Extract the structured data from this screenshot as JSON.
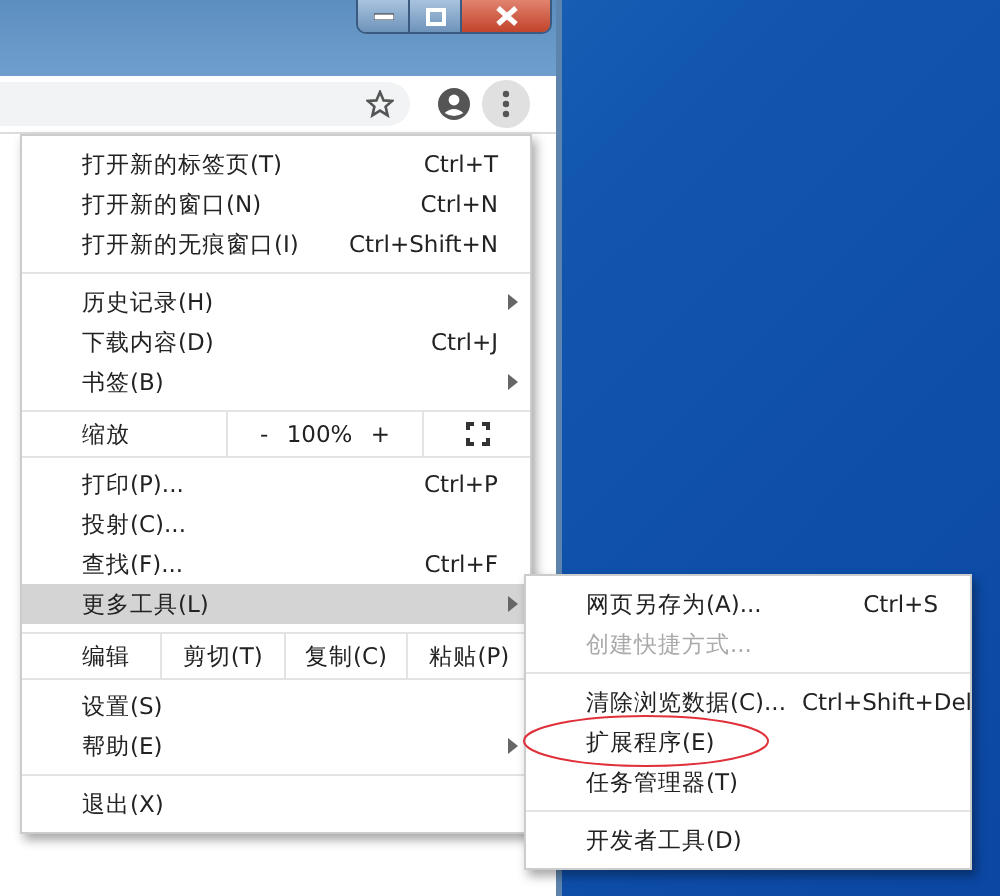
{
  "menu": {
    "items": [
      {
        "kind": "item",
        "label": "打开新的标签页(T)",
        "shortcut": "Ctrl+T",
        "has_submenu": false,
        "selected": false
      },
      {
        "kind": "item",
        "label": "打开新的窗口(N)",
        "shortcut": "Ctrl+N",
        "has_submenu": false,
        "selected": false
      },
      {
        "kind": "item",
        "label": "打开新的无痕窗口(I)",
        "shortcut": "Ctrl+Shift+N",
        "has_submenu": false,
        "selected": false
      },
      {
        "kind": "divider"
      },
      {
        "kind": "item",
        "label": "历史记录(H)",
        "has_submenu": true,
        "selected": false
      },
      {
        "kind": "item",
        "label": "下载内容(D)",
        "shortcut": "Ctrl+J",
        "has_submenu": false,
        "selected": false
      },
      {
        "kind": "item",
        "label": "书签(B)",
        "has_submenu": true,
        "selected": false
      },
      {
        "kind": "zoom",
        "label": "缩放",
        "minus": "-",
        "value": "100%",
        "plus": "+"
      },
      {
        "kind": "item",
        "label": "打印(P)...",
        "shortcut": "Ctrl+P",
        "has_submenu": false,
        "selected": false
      },
      {
        "kind": "item",
        "label": "投射(C)...",
        "has_submenu": false,
        "selected": false
      },
      {
        "kind": "item",
        "label": "查找(F)...",
        "shortcut": "Ctrl+F",
        "has_submenu": false,
        "selected": false
      },
      {
        "kind": "item",
        "label": "更多工具(L)",
        "has_submenu": true,
        "selected": true
      },
      {
        "kind": "edit",
        "label": "编辑",
        "buttons": [
          "剪切(T)",
          "复制(C)",
          "粘贴(P)"
        ]
      },
      {
        "kind": "item",
        "label": "设置(S)",
        "has_submenu": false,
        "selected": false
      },
      {
        "kind": "item",
        "label": "帮助(E)",
        "has_submenu": true,
        "selected": false
      },
      {
        "kind": "divider"
      },
      {
        "kind": "item",
        "label": "退出(X)",
        "has_submenu": false,
        "selected": false
      }
    ]
  },
  "submenu": {
    "items": [
      {
        "kind": "item",
        "label": "网页另存为(A)...",
        "shortcut": "Ctrl+S",
        "disabled": false,
        "circled": false
      },
      {
        "kind": "item",
        "label": "创建快捷方式...",
        "disabled": true,
        "circled": false
      },
      {
        "kind": "divider"
      },
      {
        "kind": "item",
        "label": "清除浏览数据(C)...",
        "shortcut": "Ctrl+Shift+Del",
        "disabled": false,
        "circled": false
      },
      {
        "kind": "item",
        "label": "扩展程序(E)",
        "disabled": false,
        "circled": true
      },
      {
        "kind": "item",
        "label": "任务管理器(T)",
        "disabled": false,
        "circled": false
      },
      {
        "kind": "divider"
      },
      {
        "kind": "item",
        "label": "开发者工具(D)",
        "disabled": false,
        "circled": false
      }
    ]
  }
}
